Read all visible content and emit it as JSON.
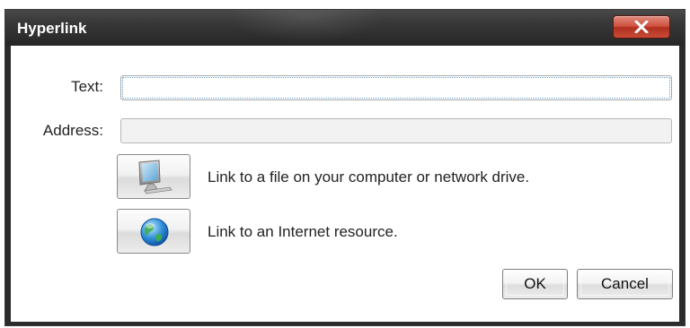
{
  "window": {
    "title": "Hyperlink",
    "close_label": "X"
  },
  "form": {
    "text_label": "Text:",
    "text_value": "",
    "address_label": "Address:",
    "address_value": ""
  },
  "links": {
    "file_icon": "computer-icon",
    "file_text": "Link to a file on your computer or network drive.",
    "web_icon": "globe-icon",
    "web_text": "Link to an Internet resource."
  },
  "buttons": {
    "ok_label": "OK",
    "cancel_label": "Cancel"
  },
  "colors": {
    "title_bar": "#2b2b2b",
    "close_button": "#cf4f3c",
    "dialog_background": "#ffffff"
  }
}
